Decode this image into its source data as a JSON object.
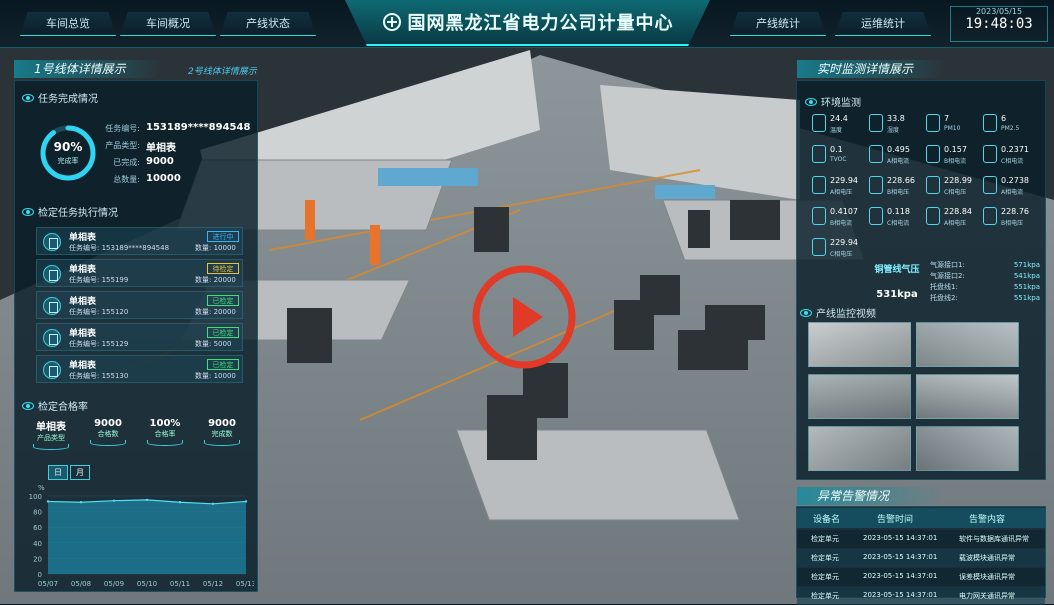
{
  "nav": {
    "left": [
      "车间总览",
      "车间概况",
      "产线状态"
    ],
    "right": [
      "产线统计",
      "运维统计"
    ]
  },
  "title": "国网黑龙江省电力公司计量中心",
  "clock": {
    "date": "2023/05/15",
    "time": "19:48:03"
  },
  "left_panel": {
    "tab_active": "1号线体详情展示",
    "tab_inactive": "2号线体详情展示",
    "task_section": "任务完成情况",
    "completion": {
      "percent": "90%",
      "label": "完成率",
      "value": 0.9
    },
    "task_fields": [
      {
        "label": "任务编号:",
        "value": "153189****894548"
      },
      {
        "label": "产品类型:",
        "value": "单相表"
      },
      {
        "label": "已完成:",
        "value": "9000"
      },
      {
        "label": "总数量:",
        "value": "10000"
      }
    ],
    "exec_section": "检定任务执行情况",
    "tasks": [
      {
        "name": "单相表",
        "code": "任务编号: 153189****894548",
        "qty": "数量: 10000",
        "status": "进行中",
        "color": "#33b5ff"
      },
      {
        "name": "单相表",
        "code": "任务编号: 155199",
        "qty": "数量: 20000",
        "status": "待检定",
        "color": "#e9c23a"
      },
      {
        "name": "单相表",
        "code": "任务编号: 155120",
        "qty": "数量: 20000",
        "status": "已检定",
        "color": "#3fe07a"
      },
      {
        "name": "单相表",
        "code": "任务编号: 155129",
        "qty": "数量: 5000",
        "status": "已检定",
        "color": "#3fe07a"
      },
      {
        "name": "单相表",
        "code": "任务编号: 155130",
        "qty": "数量: 10000",
        "status": "已检定",
        "color": "#3fe07a"
      }
    ],
    "pass_section": "检定合格率",
    "pass_stats": [
      {
        "value": "单相表",
        "label": "产品类型"
      },
      {
        "value": "9000",
        "label": "合格数"
      },
      {
        "value": "100%",
        "label": "合格率"
      },
      {
        "value": "9000",
        "label": "完成数"
      }
    ],
    "chart_toggle": [
      "日",
      "月"
    ]
  },
  "chart_data": {
    "type": "area",
    "ylabel": "%",
    "ylim": [
      0,
      100
    ],
    "yticks": [
      "100",
      "80",
      "60",
      "40",
      "20",
      "0"
    ],
    "categories": [
      "05/07",
      "05/08",
      "05/09",
      "05/10",
      "05/11",
      "05/12",
      "05/13"
    ],
    "values": [
      93,
      92,
      94,
      95,
      92,
      90,
      93
    ]
  },
  "right_panel": {
    "header": "实时监测详情展示",
    "env_section": "环境监测",
    "env": [
      {
        "v": "24.4",
        "l": "温度"
      },
      {
        "v": "33.8",
        "l": "湿度"
      },
      {
        "v": "7",
        "l": "PM10"
      },
      {
        "v": "6",
        "l": "PM2.5"
      },
      {
        "v": "0.1",
        "l": "TVOC"
      },
      {
        "v": "0.495",
        "l": "A相电流"
      },
      {
        "v": "0.157",
        "l": "B相电流"
      },
      {
        "v": "0.2371",
        "l": "C相电流"
      },
      {
        "v": "229.94",
        "l": "A相电压"
      },
      {
        "v": "228.66",
        "l": "B相电压"
      },
      {
        "v": "228.99",
        "l": "C相电压"
      },
      {
        "v": "0.2738",
        "l": "A相电流"
      },
      {
        "v": "0.4107",
        "l": "B相电流"
      },
      {
        "v": "0.118",
        "l": "C相电流"
      },
      {
        "v": "228.84",
        "l": "A相电压"
      },
      {
        "v": "228.76",
        "l": "B相电压"
      },
      {
        "v": "229.94",
        "l": "C相电压"
      }
    ],
    "pressure": {
      "title": "铜管线气压",
      "value": "531kpa",
      "l1": "气源接口1:",
      "v1": "571kpa",
      "l2": "气源接口2:",
      "v2": "541kpa",
      "l3": "托盘线1:",
      "v3": "551kpa",
      "l4": "托盘线2:",
      "v4": "551kpa"
    },
    "video_section": "产线监控视频",
    "alarm_header": "异常告警情况",
    "alarm_cols": [
      "设备名",
      "告警时间",
      "告警内容"
    ],
    "alarms": [
      {
        "dev": "检定单元",
        "time": "2023-05-15 14:37:01",
        "msg": "软件与数据库通讯异常"
      },
      {
        "dev": "检定单元",
        "time": "2023-05-15 14:37:01",
        "msg": "载波模块通讯异常"
      },
      {
        "dev": "检定单元",
        "time": "2023-05-15 14:37:01",
        "msg": "误差模块通讯异常"
      },
      {
        "dev": "检定单元",
        "time": "2023-05-15 14:37:01",
        "msg": "电力网关通讯异常"
      }
    ]
  }
}
